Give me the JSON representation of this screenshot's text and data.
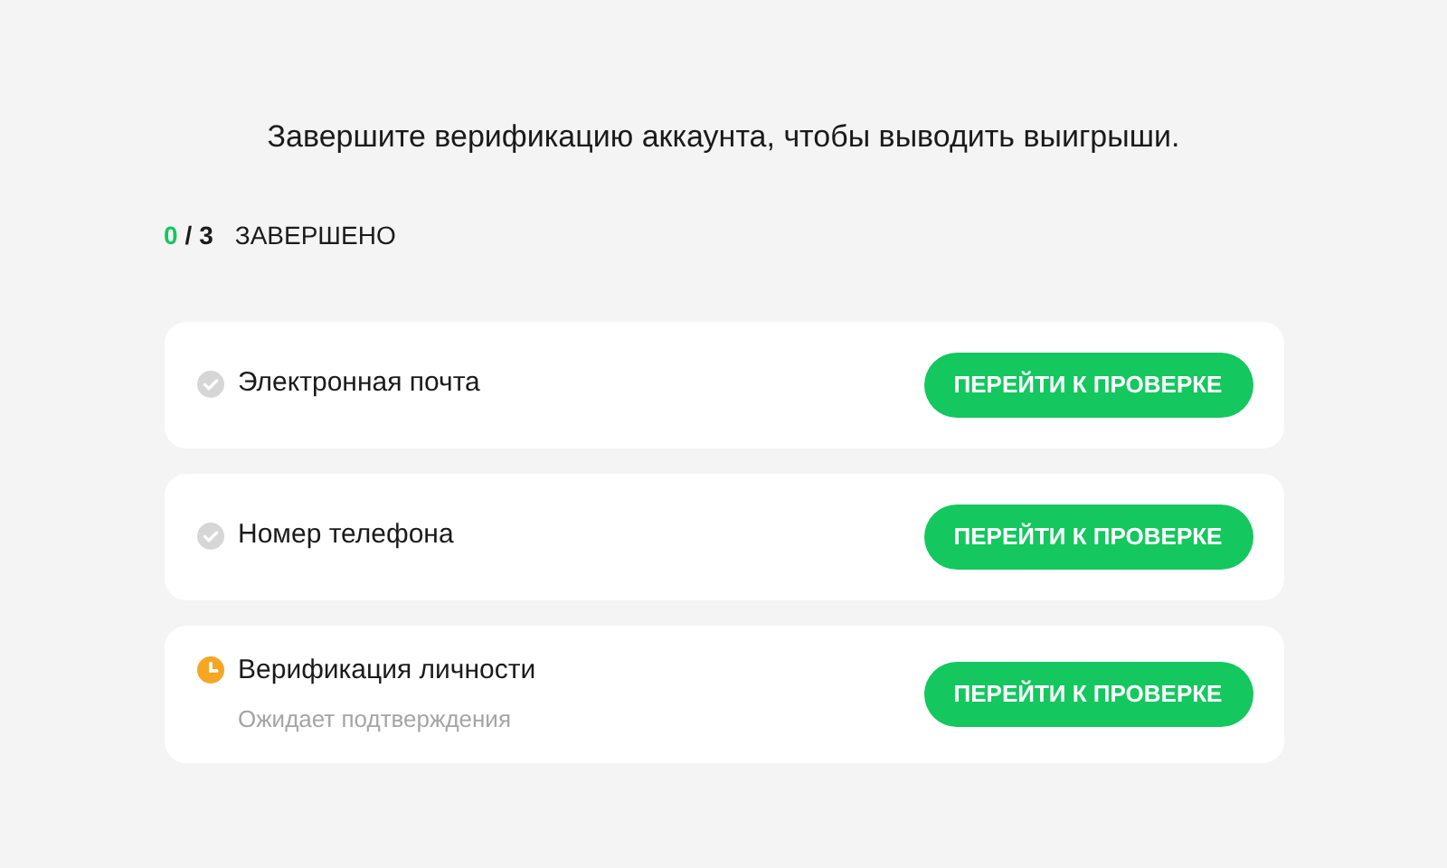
{
  "heading": "Завершите верификацию аккаунта, чтобы выводить выигрыши.",
  "progress": {
    "done": "0",
    "separator": "/ 3",
    "label": "ЗАВЕРШЕНО"
  },
  "items": [
    {
      "title": "Электронная почта",
      "kind": "check",
      "button": "ПЕРЕЙТИ К ПРОВЕРКЕ"
    },
    {
      "title": "Номер телефона",
      "kind": "check",
      "button": "ПЕРЕЙТИ К ПРОВЕРКЕ"
    },
    {
      "title": "Верификация личности",
      "kind": "clock",
      "note": "Ожидает подтверждения",
      "button": "ПЕРЕЙТИ К ПРОВЕРКЕ"
    }
  ]
}
